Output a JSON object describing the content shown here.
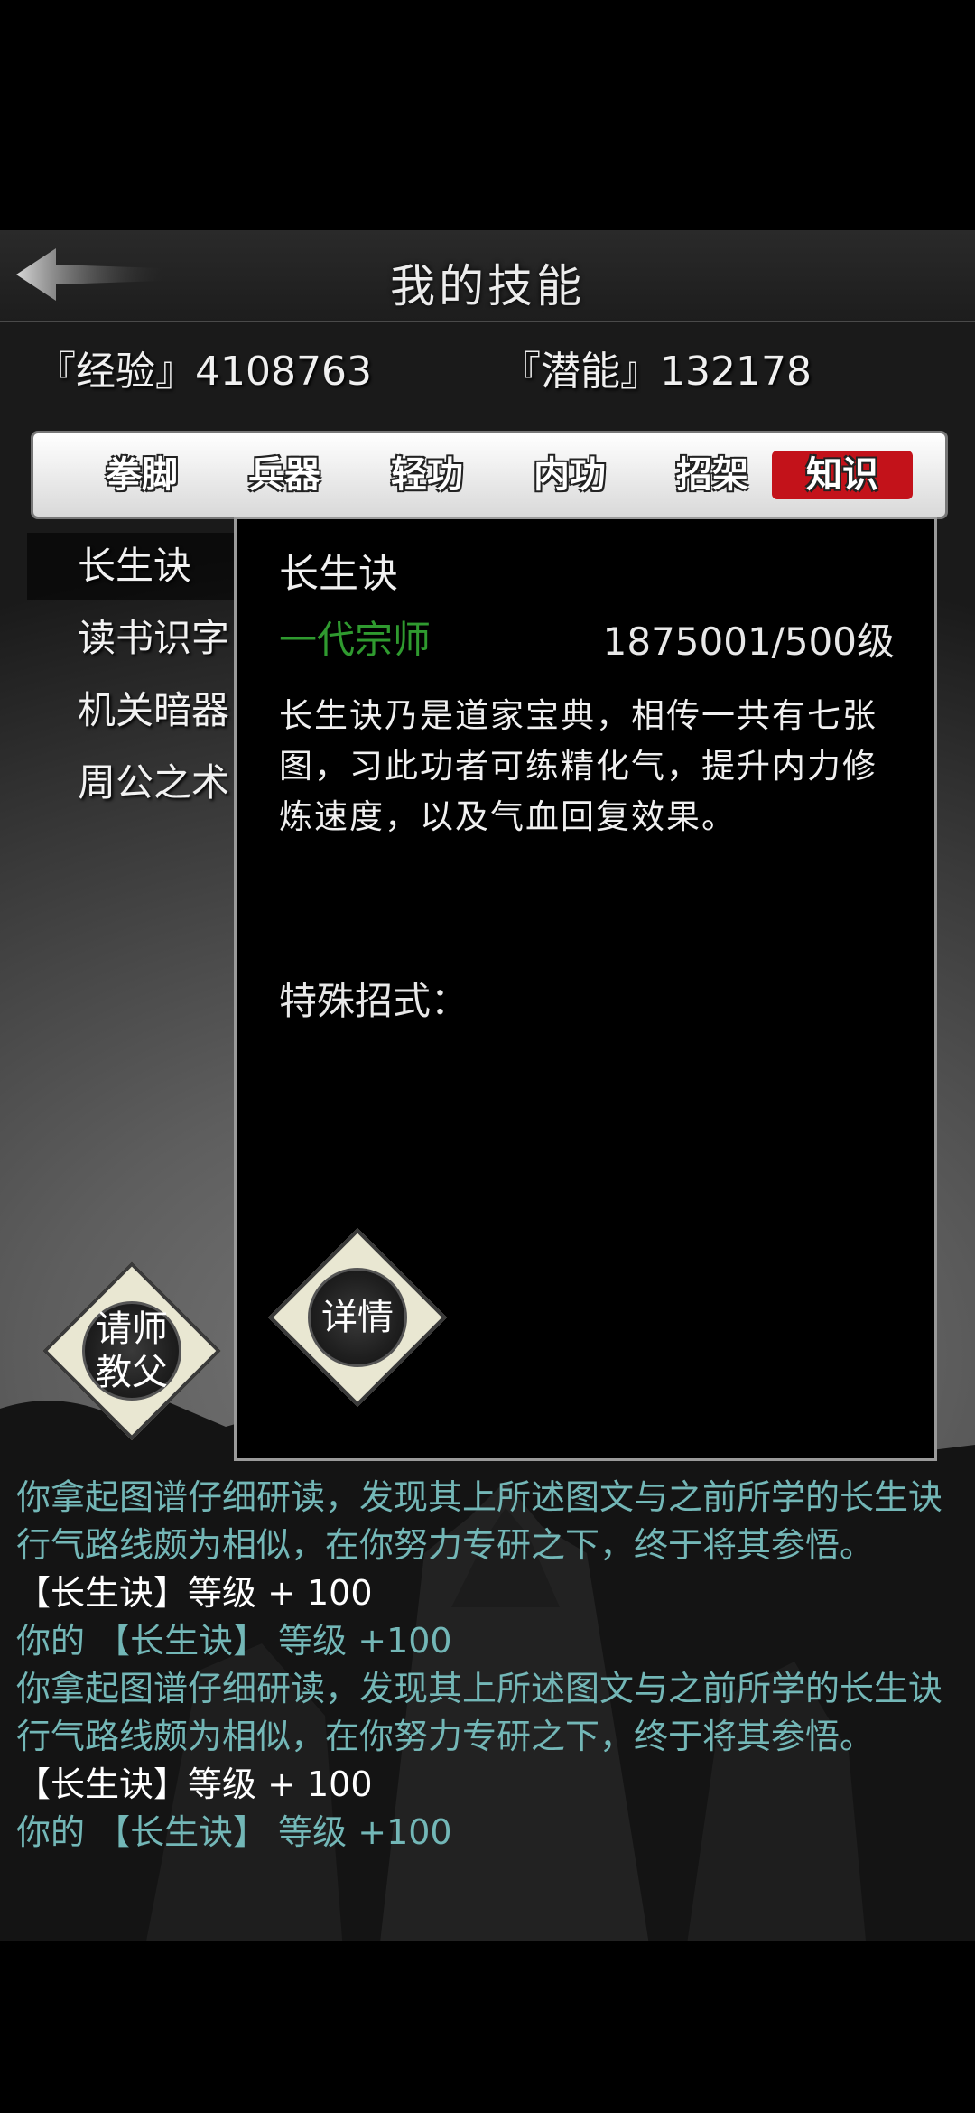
{
  "header": {
    "title": "我的技能",
    "back_icon": "back-arrow-icon"
  },
  "stats": {
    "experience_label": "『经验』4108763",
    "potential_label": "『潜能』132178"
  },
  "tabs": [
    {
      "label": "拳脚",
      "active": false
    },
    {
      "label": "兵器",
      "active": false
    },
    {
      "label": "轻功",
      "active": false
    },
    {
      "label": "内功",
      "active": false
    },
    {
      "label": "招架",
      "active": false
    },
    {
      "label": "知识",
      "active": true
    }
  ],
  "skills": [
    {
      "label": "长生诀",
      "selected": true
    },
    {
      "label": "读书识字",
      "selected": false
    },
    {
      "label": "机关暗器",
      "selected": false
    },
    {
      "label": "周公之术",
      "selected": false
    }
  ],
  "detail": {
    "name": "长生诀",
    "rank": "一代宗师",
    "level": "1875001/500级",
    "description": "长生诀乃是道家宝典，相传一共有七张图，习此功者可练精化气，提升内力修炼速度，以及气血回复效果。",
    "special_moves_label": "特殊招式：",
    "details_button": "详情"
  },
  "teacher_button": {
    "line1": "请师",
    "line2": "教父"
  },
  "log": [
    {
      "text": "你拿起图谱仔细研读，发现其上所述图文与之前所学的长生诀行气路线颇为相似，在你努力专研之下，终于将其参悟。",
      "color": "teal"
    },
    {
      "text": "【长生诀】等级 + 100",
      "color": "white"
    },
    {
      "text": "你的 【长生诀】 等级 +100",
      "color": "teal"
    },
    {
      "text": "你拿起图谱仔细研读，发现其上所述图文与之前所学的长生诀行气路线颇为相似，在你努力专研之下，终于将其参悟。",
      "color": "teal"
    },
    {
      "text": "【长生诀】等级 + 100",
      "color": "white"
    },
    {
      "text": "你的 【长生诀】 等级 +100",
      "color": "teal"
    }
  ],
  "colors": {
    "active_tab": "#c3121a",
    "rank_green": "#2f9a2f",
    "log_teal": "#73b7b7"
  }
}
